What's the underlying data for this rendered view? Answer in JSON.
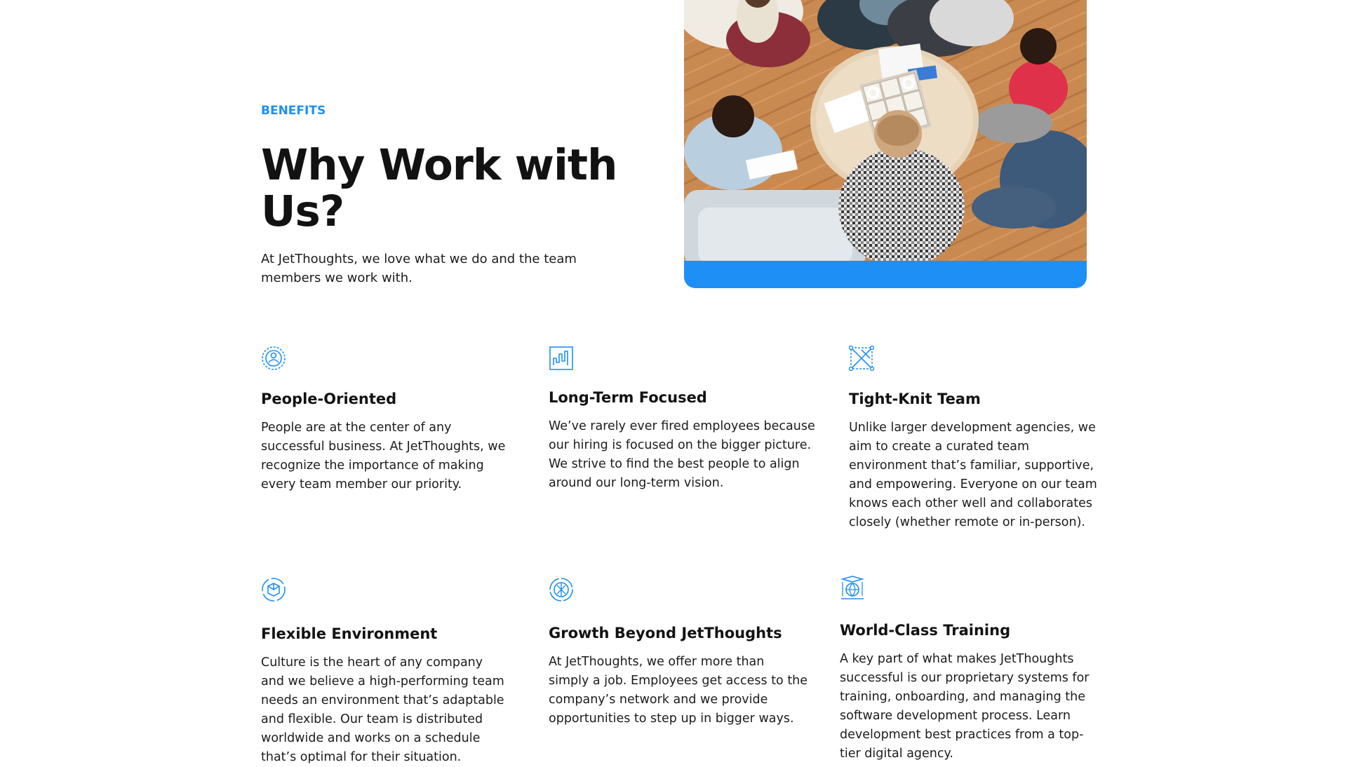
{
  "hero": {
    "eyebrow": "BENEFITS",
    "title": "Why Work with Us?",
    "subtitle": "At JetThoughts, we love what we do and the team members we work with.",
    "image_icon": "team-meeting-photo"
  },
  "colors": {
    "accent": "#1e8ff5",
    "heading": "#121212",
    "body": "#1c1c1c"
  },
  "features": [
    {
      "icon": "people-circle-icon",
      "title": "People-Oriented",
      "text": "People are at the center of any successful business. At JetThoughts, we recognize the importance of making every team member our priority."
    },
    {
      "icon": "growth-chart-icon",
      "title": "Long-Term Focused",
      "text": "We’ve rarely ever fired employees because our hiring is focused on the bigger picture. We strive to find the best people to align around our long-term vision."
    },
    {
      "icon": "network-nodes-icon",
      "title": "Tight-Knit Team",
      "text": "Unlike larger development agencies, we aim to create a curated team environment that’s familiar, supportive, and empowering. Everyone on our team knows each other well and collaborates closely (whether remote or in-person)."
    },
    {
      "icon": "cube-cycle-icon",
      "title": "Flexible Environment",
      "text": "Culture is the heart of any company and we believe a high-performing team needs an environment that’s adaptable and flexible. Our team is distributed worldwide and works on a schedule that’s optimal for their situation."
    },
    {
      "icon": "aperture-growth-icon",
      "title": "Growth Beyond JetThoughts",
      "text": "At JetThoughts, we offer more than simply a job. Employees get access to the company’s network and we provide opportunities to step up in bigger ways."
    },
    {
      "icon": "globe-graduation-icon",
      "title": "World-Class Training",
      "text": "A key part of what makes JetThoughts successful is our proprietary systems for training, onboarding, and managing the software development process. Learn development best practices from a top-tier digital agency."
    }
  ]
}
